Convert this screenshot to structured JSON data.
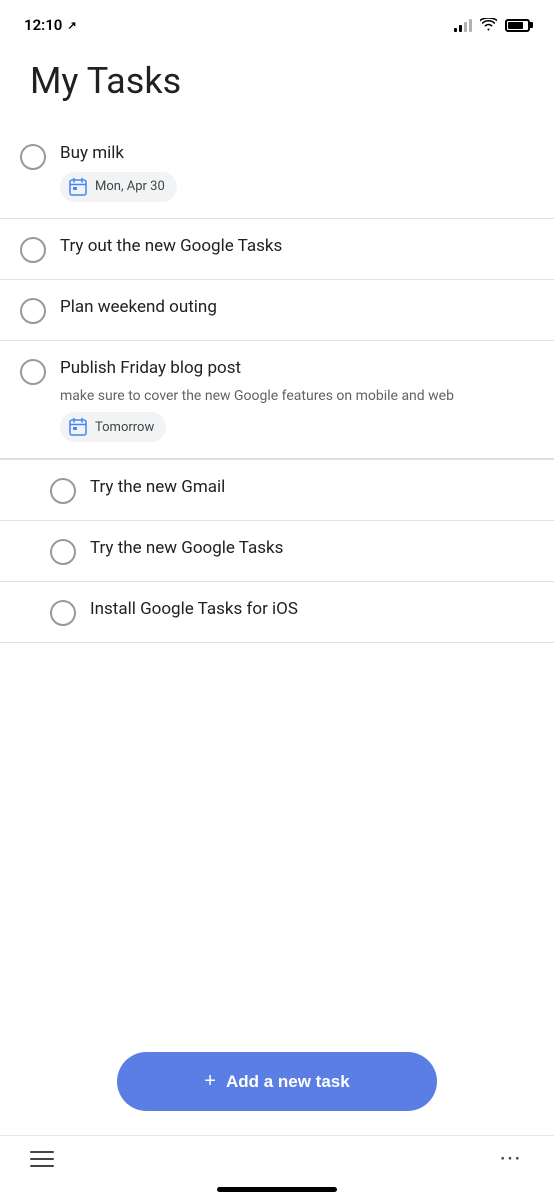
{
  "statusBar": {
    "time": "12:10",
    "locationIcon": "↗"
  },
  "pageTitle": "My Tasks",
  "tasks": [
    {
      "id": "buy-milk",
      "title": "Buy milk",
      "note": "",
      "date": "Mon, Apr 30",
      "indented": false
    },
    {
      "id": "try-google-tasks",
      "title": "Try out the new Google Tasks",
      "note": "",
      "date": "",
      "indented": false
    },
    {
      "id": "plan-weekend",
      "title": "Plan weekend outing",
      "note": "",
      "date": "",
      "indented": false
    },
    {
      "id": "publish-blog",
      "title": "Publish Friday blog post",
      "note": "make sure to cover the new Google features on mobile and web",
      "date": "Tomorrow",
      "indented": false
    },
    {
      "id": "try-gmail",
      "title": "Try the new Gmail",
      "note": "",
      "date": "",
      "indented": true
    },
    {
      "id": "try-google-tasks-2",
      "title": "Try the new Google Tasks",
      "note": "",
      "date": "",
      "indented": true
    },
    {
      "id": "install-ios",
      "title": "Install Google Tasks for iOS",
      "note": "",
      "date": "",
      "indented": true
    }
  ],
  "addTaskButton": {
    "label": "Add a new task",
    "plus": "+"
  },
  "bottomNav": {
    "menuIcon": "menu",
    "moreIcon": "⋯"
  }
}
